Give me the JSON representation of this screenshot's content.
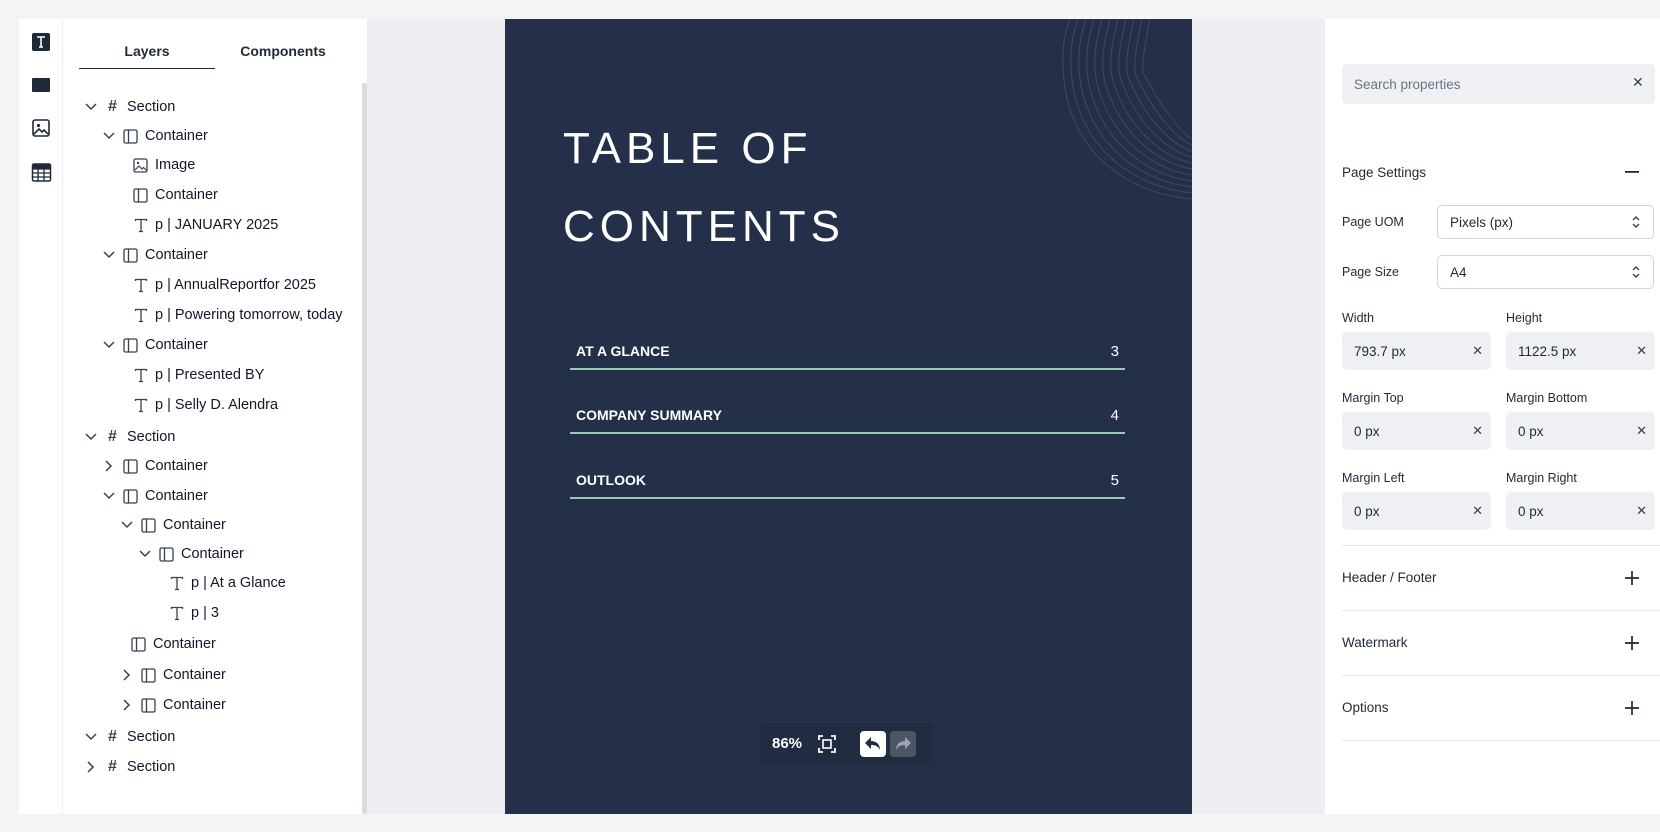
{
  "rail": {
    "icons": [
      "text-tool-icon",
      "rectangle-tool-icon",
      "image-tool-icon",
      "table-tool-icon"
    ]
  },
  "layers_panel": {
    "tabs": [
      {
        "label": "Layers",
        "active": true
      },
      {
        "label": "Components",
        "active": false
      }
    ],
    "tree": [
      {
        "label": "Section",
        "type": "section",
        "expanded": true
      },
      {
        "label": "Container",
        "type": "container",
        "expanded": true
      },
      {
        "label": "Image",
        "type": "image"
      },
      {
        "label": "Container",
        "type": "container"
      },
      {
        "label": "p | JANUARY 2025",
        "type": "text"
      },
      {
        "label": "Container",
        "type": "container",
        "expanded": true
      },
      {
        "label": "p | AnnualReportfor 2025",
        "type": "text"
      },
      {
        "label": "p | Powering tomorrow, today",
        "type": "text"
      },
      {
        "label": "Container",
        "type": "container",
        "expanded": true
      },
      {
        "label": "p | Presented BY",
        "type": "text"
      },
      {
        "label": "p | Selly D. Alendra",
        "type": "text"
      },
      {
        "label": "Section",
        "type": "section",
        "expanded": true
      },
      {
        "label": "Container",
        "type": "container",
        "expanded": false
      },
      {
        "label": "Container",
        "type": "container",
        "expanded": true
      },
      {
        "label": "Container",
        "type": "container",
        "expanded": true
      },
      {
        "label": "Container",
        "type": "container",
        "expanded": true
      },
      {
        "label": "p | At a Glance",
        "type": "text"
      },
      {
        "label": "p | 3",
        "type": "text"
      },
      {
        "label": "Container",
        "type": "container"
      },
      {
        "label": "Container",
        "type": "container",
        "expanded": false
      },
      {
        "label": "Container",
        "type": "container",
        "expanded": false
      },
      {
        "label": "Section",
        "type": "section",
        "expanded": true
      },
      {
        "label": "Section",
        "type": "section",
        "expanded": false
      }
    ]
  },
  "document": {
    "title_line1": "TABLE OF",
    "title_line2": "CONTENTS",
    "background_color": "#24304a",
    "accent_color": "#8fd0b0",
    "toc": [
      {
        "label": "AT A GLANCE",
        "page": "3"
      },
      {
        "label": "COMPANY SUMMARY",
        "page": "4"
      },
      {
        "label": "OUTLOOK",
        "page": "5"
      }
    ]
  },
  "zoom_bar": {
    "zoom": "86%",
    "icons": [
      "fit-screen-icon",
      "undo-icon",
      "redo-icon"
    ]
  },
  "properties_panel": {
    "search_placeholder": "Search properties",
    "page_settings_title": "Page Settings",
    "page_uom_label": "Page UOM",
    "page_uom_value": "Pixels (px)",
    "page_size_label": "Page Size",
    "page_size_value": "A4",
    "width_label": "Width",
    "width_value": "793.7 px",
    "height_label": "Height",
    "height_value": "1122.5 px",
    "margin_top_label": "Margin Top",
    "margin_top_value": "0 px",
    "margin_bottom_label": "Margin Bottom",
    "margin_bottom_value": "0 px",
    "margin_left_label": "Margin Left",
    "margin_left_value": "0 px",
    "margin_right_label": "Margin Right",
    "margin_right_value": "0 px",
    "header_footer_title": "Header / Footer",
    "watermark_title": "Watermark",
    "options_title": "Options"
  }
}
